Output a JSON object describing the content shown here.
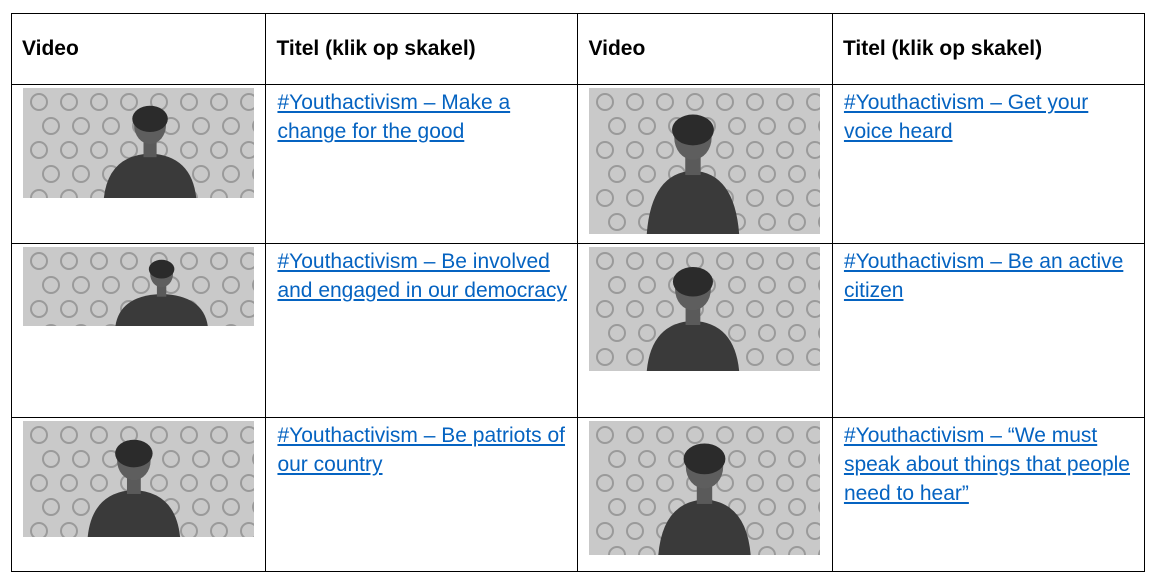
{
  "table": {
    "headers": [
      "Video",
      "Titel (klik op skakel)",
      "Video",
      "Titel (klik op skakel)"
    ],
    "rows": [
      [
        {
          "thumb_icon": "video-thumbnail-icon",
          "title": "#Youthactivism – Make a change for the good"
        },
        {
          "thumb_icon": "video-thumbnail-icon",
          "title": "#Youthactivism – Get your voice heard"
        }
      ],
      [
        {
          "thumb_icon": "video-thumbnail-icon",
          "title": "#Youthactivism – Be involved and engaged in our democracy"
        },
        {
          "thumb_icon": "video-thumbnail-icon",
          "title": "#Youthactivism – Be an active citizen"
        }
      ],
      [
        {
          "thumb_icon": "video-thumbnail-icon",
          "title": "#Youthactivism – Be patriots of our country"
        },
        {
          "thumb_icon": "video-thumbnail-icon",
          "title": "#Youthactivism – “We must speak about things that people need to hear”"
        }
      ]
    ]
  },
  "colors": {
    "link": "#0563c1",
    "border": "#000000"
  }
}
